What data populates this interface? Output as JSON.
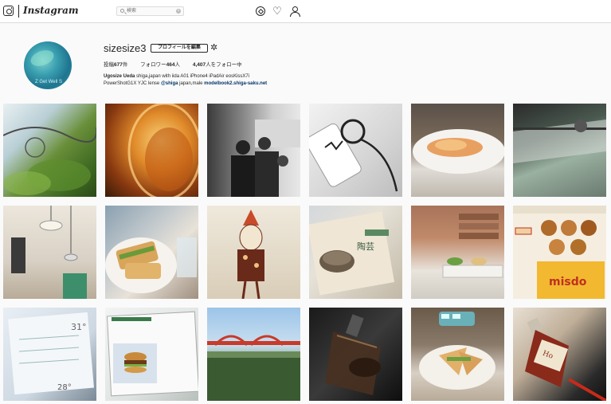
{
  "topbar": {
    "app_name": "Instagram",
    "search_placeholder": "検索",
    "clear_symbol": "⊗",
    "icons": [
      "camera-icon",
      "compass-icon",
      "heart-icon",
      "person-icon"
    ]
  },
  "profile": {
    "username": "sizesize3",
    "edit_button": "プロフィールを編集",
    "avatar_text": "Z Get Well S",
    "stats": {
      "posts_label": "投稿",
      "posts_count": "677",
      "posts_suffix": "件",
      "followers_label": "フォロワー",
      "followers_count": "464",
      "followers_suffix": "人",
      "following_count": "4,407",
      "following_suffix": "人をフォロー中"
    },
    "bio": {
      "name": "Ugosize Ueda",
      "line1_text": " shiga,japan with iida A01 iPhone4 iPadAir eosKissX7i",
      "line2_start": "PowerShotG1X YJC lense ",
      "mention": "@shiga",
      "line2_mid": " japan,male ",
      "link": "modelbook2.shiga-saku.net"
    }
  },
  "posts": [
    {
      "alt": "green leaves with metal railing"
    },
    {
      "alt": "amber glass bokeh"
    },
    {
      "alt": "black and white people"
    },
    {
      "alt": "phone case and headphones"
    },
    {
      "alt": "croissant on plate"
    },
    {
      "alt": "glass table reflection"
    },
    {
      "alt": "cafe interior lamps"
    },
    {
      "alt": "sandwich on plate"
    },
    {
      "alt": "standing figure drawing"
    },
    {
      "alt": "pottery magazine"
    },
    {
      "alt": "brick wall with bowls"
    },
    {
      "alt": "misdo donut website"
    },
    {
      "alt": "weather app 31°"
    },
    {
      "alt": "hamburger screen"
    },
    {
      "alt": "red bridge landscape"
    },
    {
      "alt": "dark glass bottle"
    },
    {
      "alt": "sandwich and mini bus"
    },
    {
      "alt": "sauce bottle"
    }
  ],
  "overlay_texts": {
    "weather_temp_high": "31°",
    "weather_temp_low": "28°",
    "misdo_brand": "misdo",
    "pottery_title": "陶芸",
    "bottle_label": "Ho"
  },
  "colors": {
    "link": "#003569",
    "border": "#dbdbdb",
    "background": "#fafafa"
  }
}
